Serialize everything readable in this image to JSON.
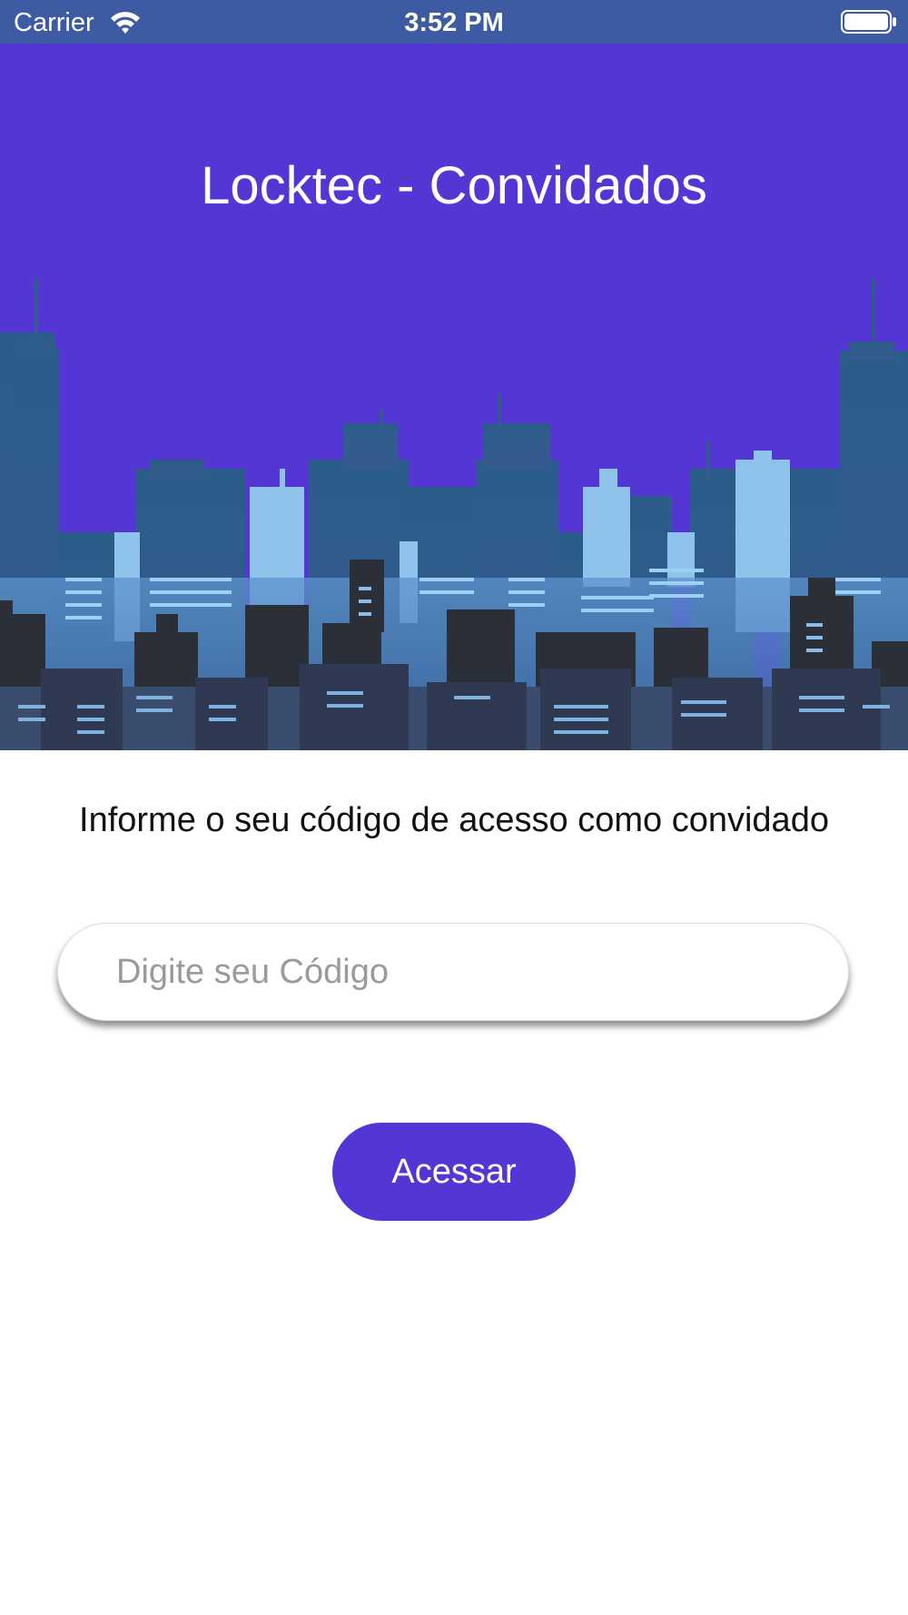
{
  "status_bar": {
    "carrier": "Carrier",
    "time": "3:52 PM",
    "wifi_icon": "wifi-icon",
    "battery_icon": "battery-icon",
    "background_color": "#3c5ba3"
  },
  "header": {
    "title": "Locktec - Convidados",
    "background_color": "#5336d4",
    "illustration": "city-skyline"
  },
  "main": {
    "prompt": "Informe o seu código de acesso como convidado",
    "code_input": {
      "value": "",
      "placeholder": "Digite seu Código"
    },
    "access_button": {
      "label": "Acessar",
      "color": "#5336d4"
    }
  }
}
